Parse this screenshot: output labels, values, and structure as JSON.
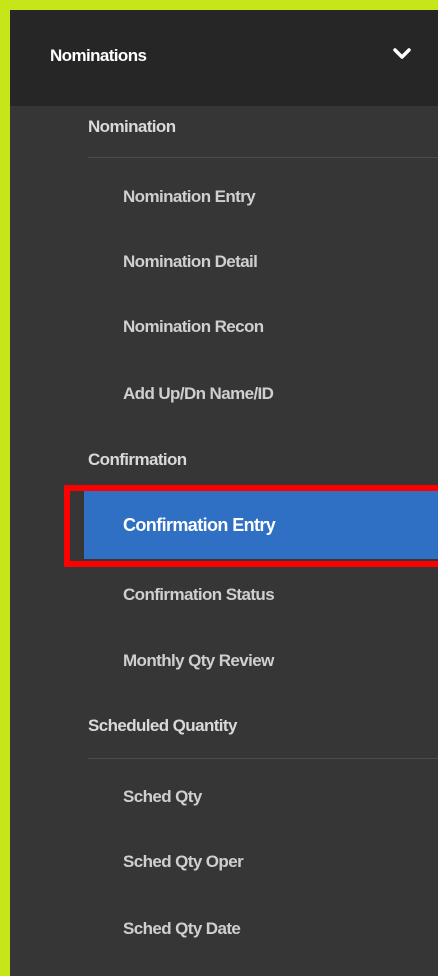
{
  "header": {
    "title": "Nominations",
    "chevron_icon": "chevron-down-icon"
  },
  "sections": [
    {
      "label": "Nomination",
      "items": [
        "Nomination Entry",
        "Nomination Detail",
        "Nomination Recon",
        "Add Up/Dn Name/ID"
      ]
    },
    {
      "label": "Confirmation",
      "items": [
        "Confirmation Entry",
        "Confirmation Status",
        "Monthly Qty Review"
      ]
    },
    {
      "label": "Scheduled Quantity",
      "items": [
        "Sched Qty",
        "Sched Qty Oper",
        "Sched Qty Date"
      ]
    }
  ],
  "active_item": "Confirmation Entry",
  "colors": {
    "frame": "#c6e61a",
    "panel": "#363636",
    "header": "#262626",
    "active": "#2f6fc4",
    "highlight": "#ff0000"
  }
}
